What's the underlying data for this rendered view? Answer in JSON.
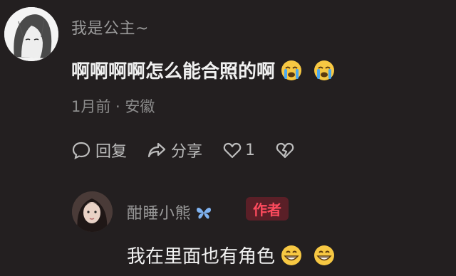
{
  "comments": [
    {
      "username": "我是公主~",
      "text": "啊啊啊啊怎么能合照的啊",
      "emojis": [
        "loudly-crying-face",
        "loudly-crying-face"
      ],
      "meta": "1月前 · 安徽",
      "actions": {
        "reply_label": "回复",
        "share_label": "分享",
        "like_count": "1"
      }
    },
    {
      "username": "酣睡小熊",
      "badge": "作者",
      "text": "我在里面也有角色",
      "emojis": [
        "grinning-face",
        "grinning-face"
      ]
    }
  ],
  "colors": {
    "background": "#231f20",
    "author_badge_bg": "#5a1f27",
    "author_badge_text": "#ff4b5e"
  }
}
